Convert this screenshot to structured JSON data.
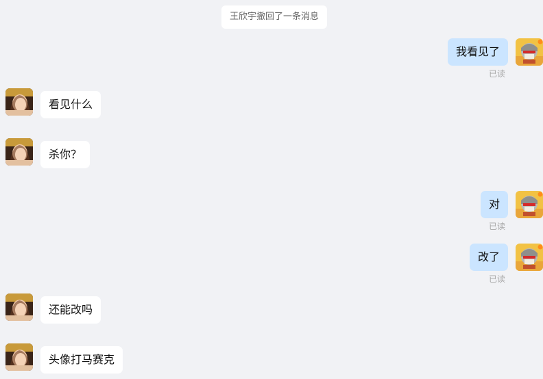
{
  "system_notice": "王欣宇撤回了一条消息",
  "read_label": "已读",
  "messages": [
    {
      "side": "right",
      "text": "我看见了"
    },
    {
      "side": "left",
      "text": "看见什么"
    },
    {
      "side": "left",
      "text": "杀你？"
    },
    {
      "side": "right",
      "text": "对"
    },
    {
      "side": "right",
      "text": "改了"
    },
    {
      "side": "left",
      "text": "还能改吗"
    },
    {
      "side": "left",
      "text": "头像打马赛克"
    }
  ],
  "avatars": {
    "other": "contact-avatar",
    "self": "self-avatar"
  }
}
